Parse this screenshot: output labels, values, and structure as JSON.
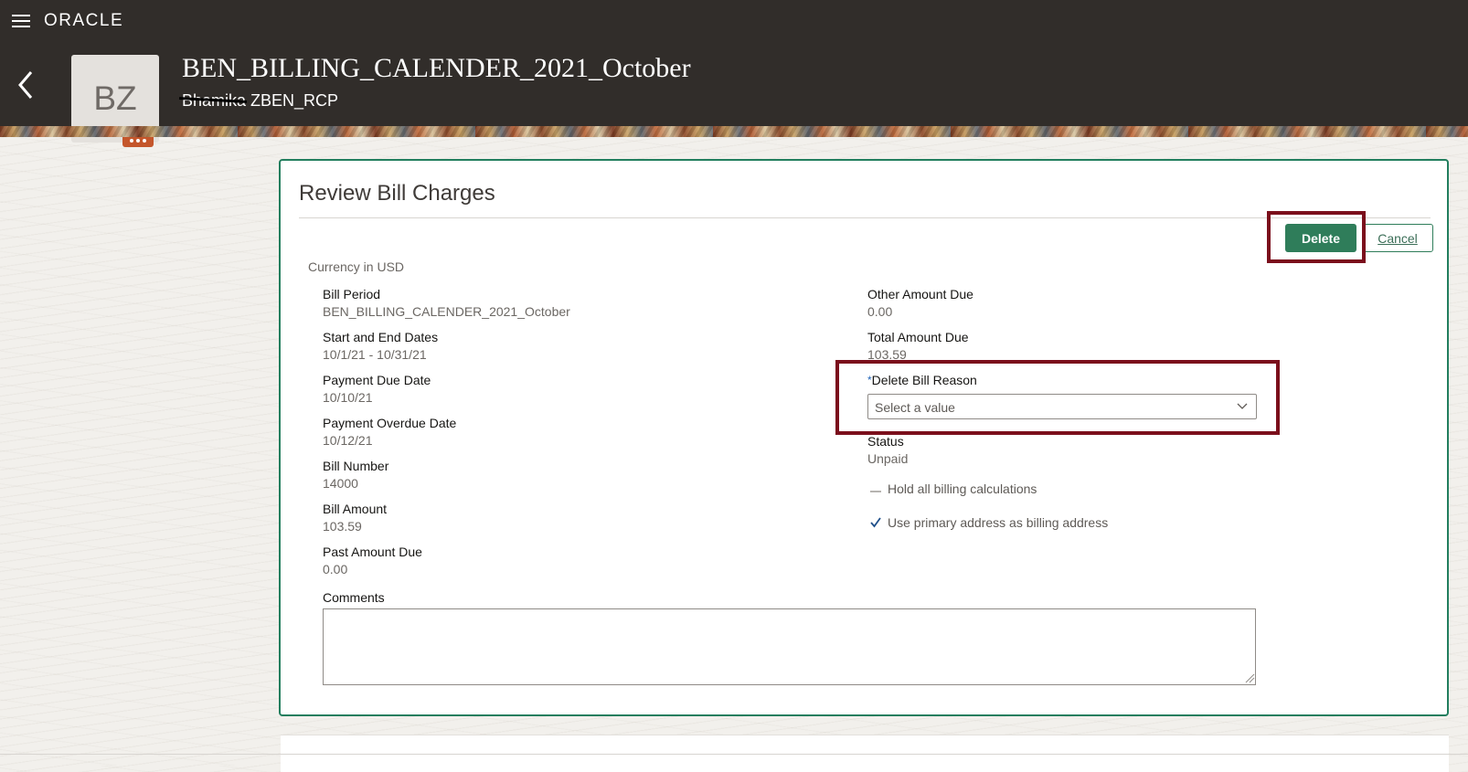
{
  "header": {
    "brand": "ORACLE",
    "title": "BEN_BILLING_CALENDER_2021_October",
    "subtitle": "Bhamika ZBEN_RCP",
    "avatar_initials": "BZ",
    "background_color": "#312d2a",
    "icons": [
      "hamburger-menu-icon",
      "back-chevron-icon",
      "more-actions-icon"
    ]
  },
  "card": {
    "title": "Review Bill Charges",
    "accent_color": "#227e5e",
    "delete_label": "Delete",
    "cancel_label": "Cancel",
    "currency_note": "Currency in USD",
    "left_fields": [
      {
        "label": "Bill Period",
        "value": "BEN_BILLING_CALENDER_2021_October"
      },
      {
        "label": "Start and End Dates",
        "value": "10/1/21 - 10/31/21"
      },
      {
        "label": "Payment Due Date",
        "value": "10/10/21"
      },
      {
        "label": "Payment Overdue Date",
        "value": "10/12/21"
      },
      {
        "label": "Bill Number",
        "value": "14000"
      },
      {
        "label": "Bill Amount",
        "value": "103.59"
      },
      {
        "label": "Past Amount Due",
        "value": "0.00"
      }
    ],
    "right_fields": [
      {
        "label": "Other Amount Due",
        "value": "0.00"
      },
      {
        "label": "Total Amount Due",
        "value": "103.59"
      }
    ],
    "delete_reason": {
      "required_marker": "*",
      "label": "Delete Bill Reason",
      "placeholder": "Select a value"
    },
    "status": {
      "label": "Status",
      "value": "Unpaid"
    },
    "checkboxes": [
      {
        "label": "Hold all billing calculations",
        "checked": false
      },
      {
        "label": "Use primary address as billing address",
        "checked": true
      }
    ],
    "comments_label": "Comments",
    "comments_value": ""
  },
  "annotation_color": "#7b0f1c"
}
